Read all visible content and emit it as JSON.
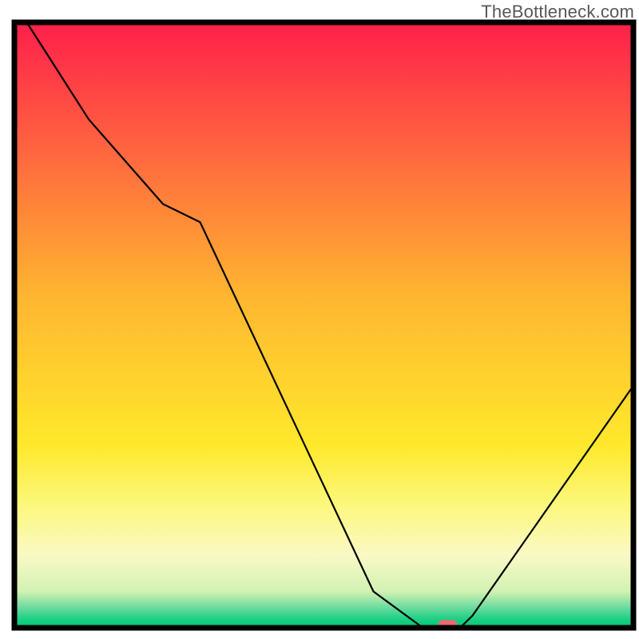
{
  "watermark": "TheBottleneck.com",
  "chart_data": {
    "type": "line",
    "title": "",
    "xlabel": "",
    "ylabel": "",
    "xlim": [
      0,
      100
    ],
    "ylim": [
      0,
      100
    ],
    "x": [
      2,
      12,
      24,
      30,
      58,
      66,
      72,
      74,
      100
    ],
    "values": [
      100,
      84,
      70,
      67,
      6,
      0,
      0,
      2,
      40
    ],
    "marker": {
      "x": 70,
      "y": 0.5,
      "color": "#e96a6d"
    },
    "gradient_stops": [
      {
        "offset": 0.0,
        "color": "#ff1f4b"
      },
      {
        "offset": 0.45,
        "color": "#ffb531"
      },
      {
        "offset": 0.7,
        "color": "#ffe92b"
      },
      {
        "offset": 0.8,
        "color": "#fcf87f"
      },
      {
        "offset": 0.88,
        "color": "#faf9c5"
      },
      {
        "offset": 0.94,
        "color": "#d1f2b2"
      },
      {
        "offset": 0.965,
        "color": "#72dca0"
      },
      {
        "offset": 0.985,
        "color": "#1ed085"
      },
      {
        "offset": 1.0,
        "color": "#00c776"
      }
    ]
  }
}
